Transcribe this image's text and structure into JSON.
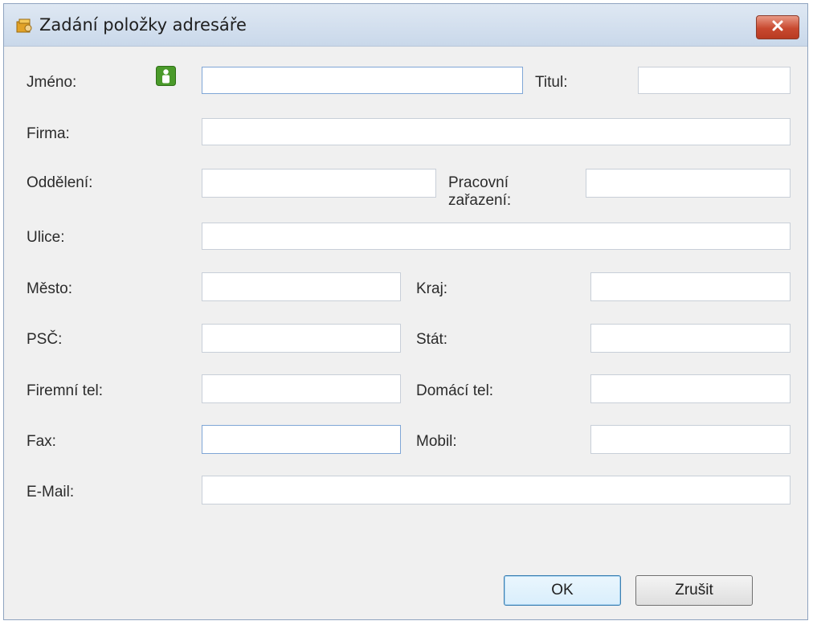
{
  "window": {
    "title": "Zadání položky adresáře",
    "close_icon": "close-icon"
  },
  "form": {
    "jmeno_label": "Jméno:",
    "jmeno_value": "",
    "contact_icon": "person-icon",
    "titul_label": "Titul:",
    "titul_value": "",
    "firma_label": "Firma:",
    "firma_value": "",
    "oddeleni_label": "Oddělení:",
    "oddeleni_value": "",
    "pracovni_label_line1": "Pracovní",
    "pracovni_label_line2": "zařazení:",
    "pracovni_value": "",
    "ulice_label": "Ulice:",
    "ulice_value": "",
    "mesto_label": "Město:",
    "mesto_value": "",
    "kraj_label": "Kraj:",
    "kraj_value": "",
    "psc_label": "PSČ:",
    "psc_value": "",
    "stat_label": "Stát:",
    "stat_value": "",
    "firemni_tel_label": "Firemní tel:",
    "firemni_tel_value": "",
    "domaci_tel_label": "Domácí tel:",
    "domaci_tel_value": "",
    "fax_label": "Fax:",
    "fax_value": "",
    "mobil_label": "Mobil:",
    "mobil_value": "",
    "email_label": "E-Mail:",
    "email_value": ""
  },
  "buttons": {
    "ok_label": "OK",
    "cancel_label": "Zrušit"
  },
  "colors": {
    "close_button": "#c8492f",
    "person_icon": "#4a9a2a"
  }
}
